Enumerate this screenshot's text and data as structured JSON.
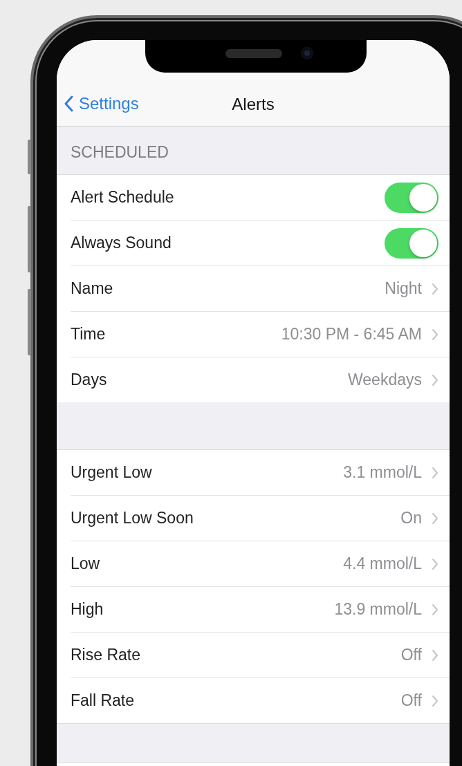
{
  "nav": {
    "back_label": "Settings",
    "title": "Alerts"
  },
  "sections": [
    {
      "header": "SCHEDULED",
      "rows": [
        {
          "kind": "toggle",
          "label": "Alert Schedule",
          "on": true
        },
        {
          "kind": "toggle",
          "label": "Always Sound",
          "on": true
        },
        {
          "kind": "disclosure",
          "label": "Name",
          "value": "Night"
        },
        {
          "kind": "disclosure",
          "label": "Time",
          "value": "10:30 PM - 6:45 AM"
        },
        {
          "kind": "disclosure",
          "label": "Days",
          "value": "Weekdays"
        }
      ]
    },
    {
      "rows": [
        {
          "kind": "disclosure",
          "label": "Urgent Low",
          "value": "3.1 mmol/L"
        },
        {
          "kind": "disclosure",
          "label": "Urgent Low Soon",
          "value": "On"
        },
        {
          "kind": "disclosure",
          "label": "Low",
          "value": "4.4 mmol/L"
        },
        {
          "kind": "disclosure",
          "label": "High",
          "value": "13.9 mmol/L"
        },
        {
          "kind": "disclosure",
          "label": "Rise Rate",
          "value": "Off"
        },
        {
          "kind": "disclosure",
          "label": "Fall Rate",
          "value": "Off"
        }
      ]
    }
  ]
}
